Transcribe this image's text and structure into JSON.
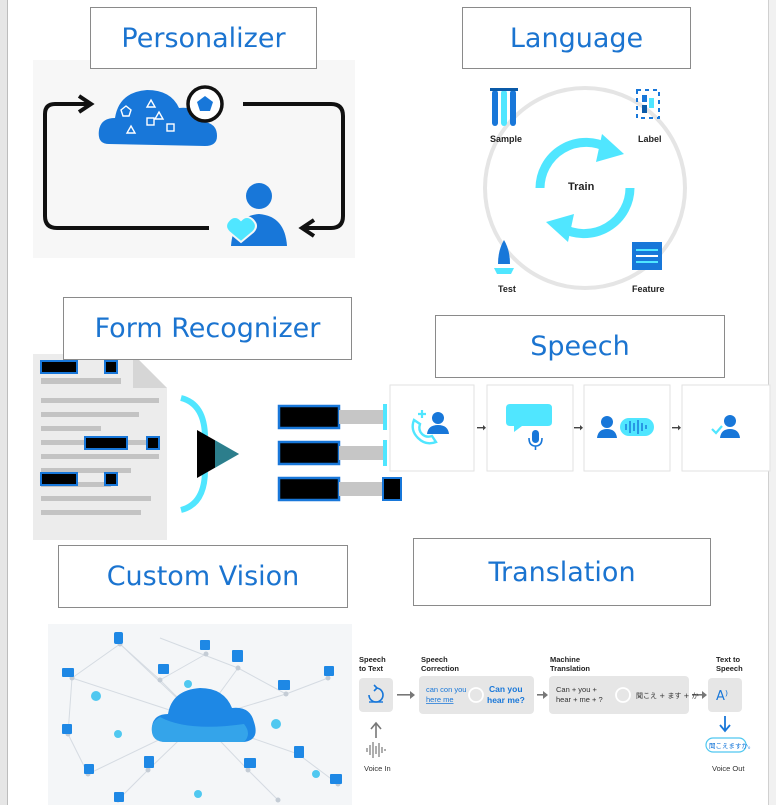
{
  "labels": {
    "personalizer": "Personalizer",
    "language": "Language",
    "form_recognizer": "Form Recognizer",
    "speech": "Speech",
    "custom_vision": "Custom Vision",
    "translation": "Translation"
  },
  "language_cycle": {
    "center": "Train",
    "sample": "Sample",
    "label": "Label",
    "test": "Test",
    "feature": "Feature"
  },
  "translation_flow": {
    "stt": "Speech",
    "stt2": "to Text",
    "sc": "Speech",
    "sc2": "Correction",
    "mt": "Machine",
    "mt2": "Translation",
    "tts": "Text to",
    "tts2": "Speech",
    "voice_in": "Voice In",
    "voice_out": "Voice Out",
    "corr_a": "can con you",
    "corr_b": "here me",
    "corr_c": "Can you",
    "corr_d": "hear me?",
    "mt_a": "Can + you +",
    "mt_b": "hear + me + ?",
    "mt_jp": "聞こえ + ます + か",
    "out_jp": "聞こえますか。",
    "tts_glyph": "A⁾"
  },
  "colors": {
    "accent_blue": "#1b74d0",
    "cyan": "#50e6ff",
    "azure": "#0078d4",
    "border": "#8a8a8a"
  }
}
